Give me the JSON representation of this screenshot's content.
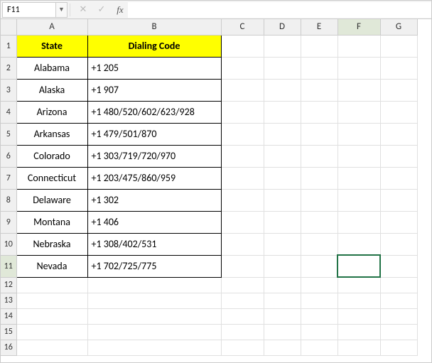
{
  "nameBox": "F11",
  "formula": "",
  "columns": [
    "A",
    "B",
    "C",
    "D",
    "E",
    "F",
    "G"
  ],
  "colWidths": [
    "col-A",
    "col-B",
    "col-C",
    "col-D",
    "col-E",
    "col-F",
    "col-G"
  ],
  "rowCount": 16,
  "selectedCell": {
    "row": 11,
    "col": 6
  },
  "headers": {
    "state": "State",
    "code": "Dialing Code"
  },
  "tableRows": [
    {
      "state": "Alabama",
      "code": "+1 205"
    },
    {
      "state": "Alaska",
      "code": "+1 907"
    },
    {
      "state": "Arizona",
      "code": "+1 480/520/602/623/928"
    },
    {
      "state": "Arkansas",
      "code": "+1 479/501/870"
    },
    {
      "state": "Colorado",
      "code": "+1 303/719/720/970"
    },
    {
      "state": "Connecticut",
      "code": "+1 203/475/860/959"
    },
    {
      "state": "Delaware",
      "code": "+1 302"
    },
    {
      "state": "Montana",
      "code": "+1 406"
    },
    {
      "state": "Nebraska",
      "code": "+1 308/402/531"
    },
    {
      "state": "Nevada",
      "code": "+1 702/725/775"
    }
  ],
  "icons": {
    "dropdown": "▼",
    "cancel": "✕",
    "enter": "✓",
    "fx": "fx"
  }
}
